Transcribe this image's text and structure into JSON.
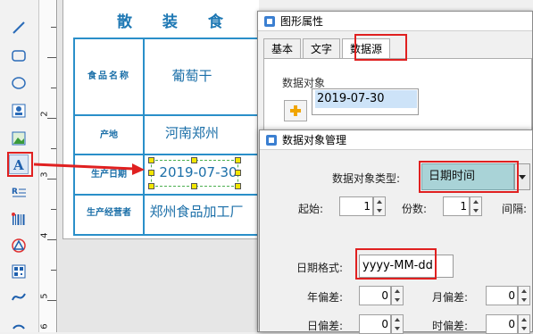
{
  "toolbar": {
    "tools": [
      "line-tool-icon",
      "rounded-rect-tool-icon",
      "ellipse-tool-icon",
      "image-tool-icon",
      "picture-tool-icon",
      "text-tool-icon",
      "rich-text-tool-icon",
      "barcode-tool-icon",
      "shape-tool-icon",
      "qrcode-tool-icon",
      "curve-tool-icon",
      "arc-tool-icon"
    ]
  },
  "ruler": {
    "numbers": [
      "2",
      "3",
      "4",
      "5",
      "6"
    ]
  },
  "label": {
    "title": "散 装 食",
    "rows": [
      {
        "label": "食品名称",
        "value": "葡萄干"
      },
      {
        "label": "产地",
        "value": "河南郑州"
      },
      {
        "label": "生产日期",
        "value": "2019-07-30"
      },
      {
        "label": "生产经营者",
        "value": "郑州食品加工厂"
      }
    ]
  },
  "dialog_props": {
    "title": "图形属性",
    "tabs": [
      "基本",
      "文字",
      "数据源"
    ],
    "selected_tab": "数据源",
    "datasource_caption": "数据对象",
    "datasource_items": [
      "2019-07-30"
    ]
  },
  "dialog_manage": {
    "title": "数据对象管理",
    "type_label": "数据对象类型:",
    "type_value": "日期时间",
    "start_label": "起始:",
    "start_value": "1",
    "digits_label": "份数:",
    "digits_value": "1",
    "interval_label": "间隔:",
    "date_format_label": "日期格式:",
    "date_format_value": "yyyy-MM-dd",
    "year_offset_label": "年偏差:",
    "year_offset_value": "0",
    "month_offset_label": "月偏差:",
    "month_offset_value": "0",
    "day_offset_label": "日偏差:",
    "day_offset_value": "0",
    "hour_offset_label": "时偏差:",
    "hour_offset_value": "0"
  },
  "colors": {
    "label_blue": "#1e78b4",
    "highlight_red": "#e02020",
    "combo_bg": "#a9d3d7"
  }
}
